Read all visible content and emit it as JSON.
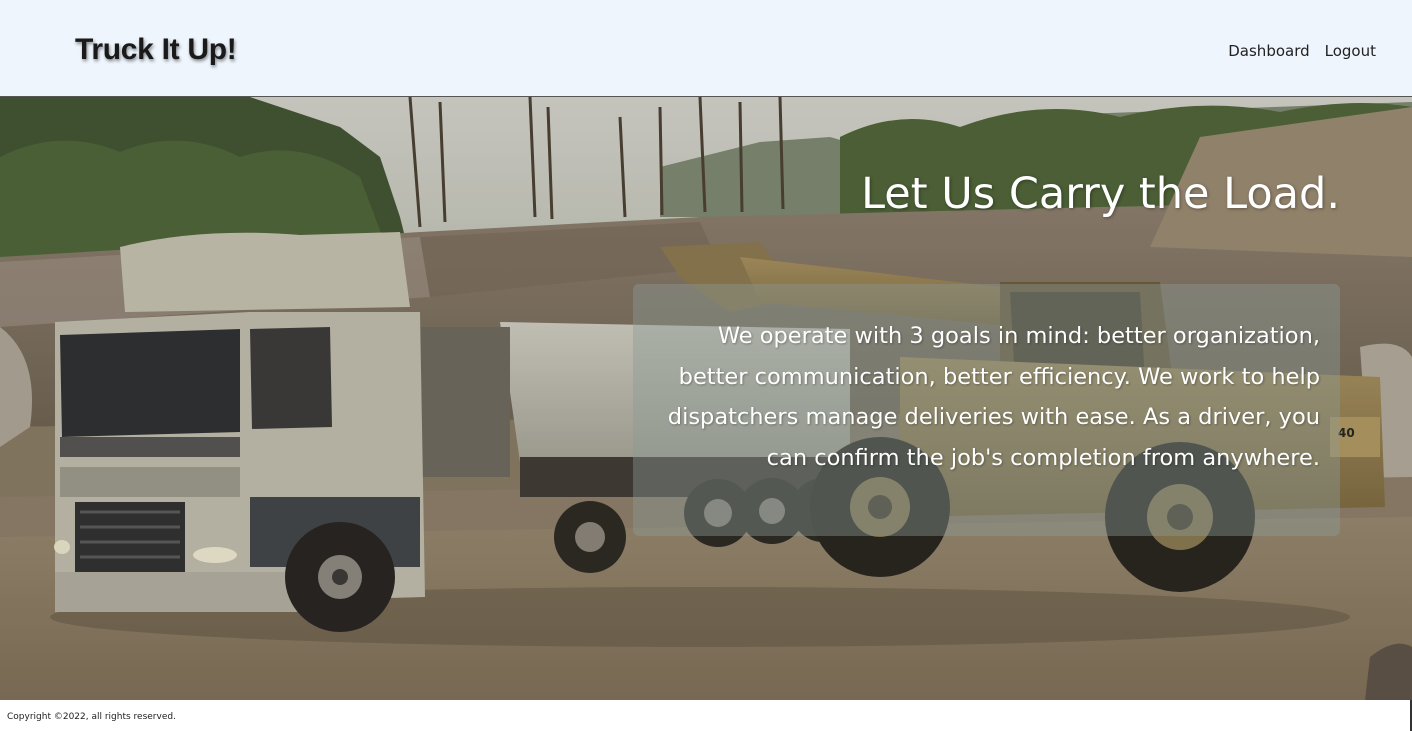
{
  "navbar": {
    "brand": "Truck It Up!",
    "links": [
      {
        "label": "Dashboard"
      },
      {
        "label": "Logout"
      }
    ]
  },
  "hero": {
    "headline": "Let Us Carry the Load.",
    "goals_text": "We operate with 3 goals in mind: better organization, better communication, better efficiency. We work to help dispatchers manage deliveries with ease. As a driver, you can confirm the job's completion from anywhere."
  },
  "footer": {
    "copyright": "Copyright ©2022, all rights reserved."
  },
  "colors": {
    "navbar_bg": "#eef5fd",
    "brand_text": "#1a1a1a",
    "hero_text": "#ffffff"
  }
}
